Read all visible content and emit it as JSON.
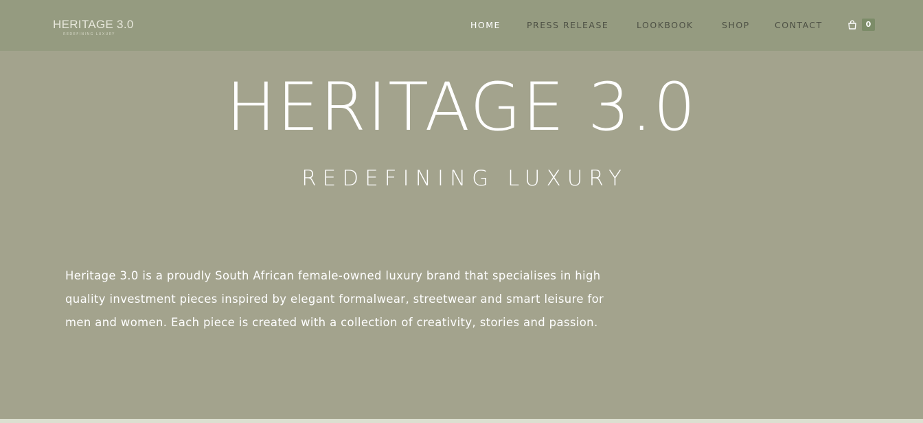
{
  "header": {
    "logo": {
      "name": "HERITAGE 3.0",
      "tagline": "REDEFINING LUXURY"
    },
    "nav": [
      {
        "label": "HOME",
        "active": true
      },
      {
        "label": "PRESS RELEASE",
        "active": false
      },
      {
        "label": "LOOKBOOK",
        "active": false
      },
      {
        "label": "SHOP",
        "active": false
      },
      {
        "label": "CONTACT",
        "active": false
      }
    ],
    "cart": {
      "icon": "shopping-bag-icon",
      "count": "0"
    }
  },
  "hero": {
    "title": "HERITAGE 3.0",
    "subtitle": "REDEFINING LUXURY"
  },
  "intro": {
    "text": "Heritage 3.0 is a proudly South African female-owned luxury brand that specialises in high quality investment pieces inspired by elegant formalwear, streetwear and smart leisure for men and women. Each piece is created with a collection of creativity, stories and passion."
  },
  "colors": {
    "header_bg": "#959b80",
    "page_bg": "#a3a38d",
    "accent": "#7c8c68",
    "nav_text": "#4d5044",
    "nav_active": "#ffffff"
  }
}
